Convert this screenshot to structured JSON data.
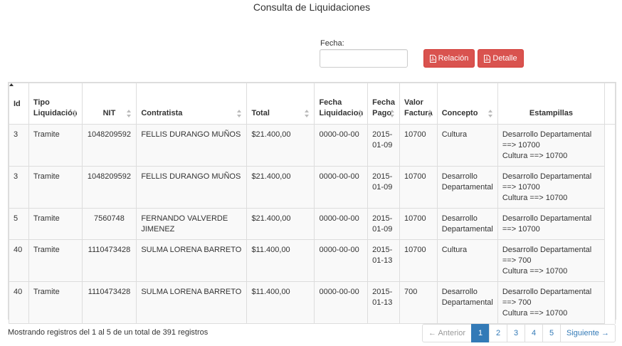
{
  "page": {
    "title": "Consulta de Liquidaciones"
  },
  "filter": {
    "label": "Fecha:",
    "value": "",
    "placeholder": ""
  },
  "buttons": {
    "relacion": "Relación",
    "detalle": "Detalle"
  },
  "colors": {
    "danger": "#d9534f",
    "primary": "#337ab7",
    "border": "#dddddd",
    "stripe": "#f9f9f9"
  },
  "table": {
    "headers": {
      "id": "Id",
      "tipo": "Tipo Liquidación",
      "nit": "NIT",
      "contratista": "Contratista",
      "total": "Total",
      "fecha_liq": "Fecha Liquidacion",
      "fecha_pago": "Fecha Pago",
      "valor_factura": "Valor Factura",
      "concepto": "Concepto",
      "estampillas": "Estampillas"
    },
    "sort": {
      "column": "Id",
      "direction": "asc"
    },
    "rows": [
      {
        "id": "3",
        "tipo": "Tramite",
        "nit": "1048209592",
        "contratista": "FELLIS DURANGO MUÑOS",
        "total": "$21.400,00",
        "fecha_liq": "0000-00-00",
        "fecha_pago": "2015-01-09",
        "valor_factura": "10700",
        "concepto": "Cultura",
        "estampillas": [
          "Desarrollo Departamental ==> 10700",
          "Cultura ==> 10700"
        ]
      },
      {
        "id": "3",
        "tipo": "Tramite",
        "nit": "1048209592",
        "contratista": "FELLIS DURANGO MUÑOS",
        "total": "$21.400,00",
        "fecha_liq": "0000-00-00",
        "fecha_pago": "2015-01-09",
        "valor_factura": "10700",
        "concepto": "Desarrollo Departamental",
        "estampillas": [
          "Desarrollo Departamental ==> 10700",
          "Cultura ==> 10700"
        ]
      },
      {
        "id": "5",
        "tipo": "Tramite",
        "nit": "7560748",
        "contratista": "FERNANDO VALVERDE JIMENEZ",
        "total": "$21.400,00",
        "fecha_liq": "0000-00-00",
        "fecha_pago": "2015-01-09",
        "valor_factura": "10700",
        "concepto": "Desarrollo Departamental",
        "estampillas": [
          "Desarrollo Departamental ==> 10700"
        ]
      },
      {
        "id": "40",
        "tipo": "Tramite",
        "nit": "1110473428",
        "contratista": "SULMA LORENA BARRETO",
        "total": "$11.400,00",
        "fecha_liq": "0000-00-00",
        "fecha_pago": "2015-01-13",
        "valor_factura": "10700",
        "concepto": "Cultura",
        "estampillas": [
          "Desarrollo Departamental ==> 700",
          "Cultura ==> 10700"
        ]
      },
      {
        "id": "40",
        "tipo": "Tramite",
        "nit": "1110473428",
        "contratista": "SULMA LORENA BARRETO",
        "total": "$11.400,00",
        "fecha_liq": "0000-00-00",
        "fecha_pago": "2015-01-13",
        "valor_factura": "700",
        "concepto": "Desarrollo Departamental",
        "estampillas": [
          "Desarrollo Departamental ==> 700",
          "Cultura ==> 10700"
        ]
      }
    ]
  },
  "footer": {
    "info": "Mostrando registros del 1 al 5 de un total de 391 registros",
    "pagination": {
      "previous": "← Anterior",
      "pages": [
        "1",
        "2",
        "3",
        "4",
        "5"
      ],
      "active_page": "1",
      "next": "Siguiente →"
    }
  }
}
